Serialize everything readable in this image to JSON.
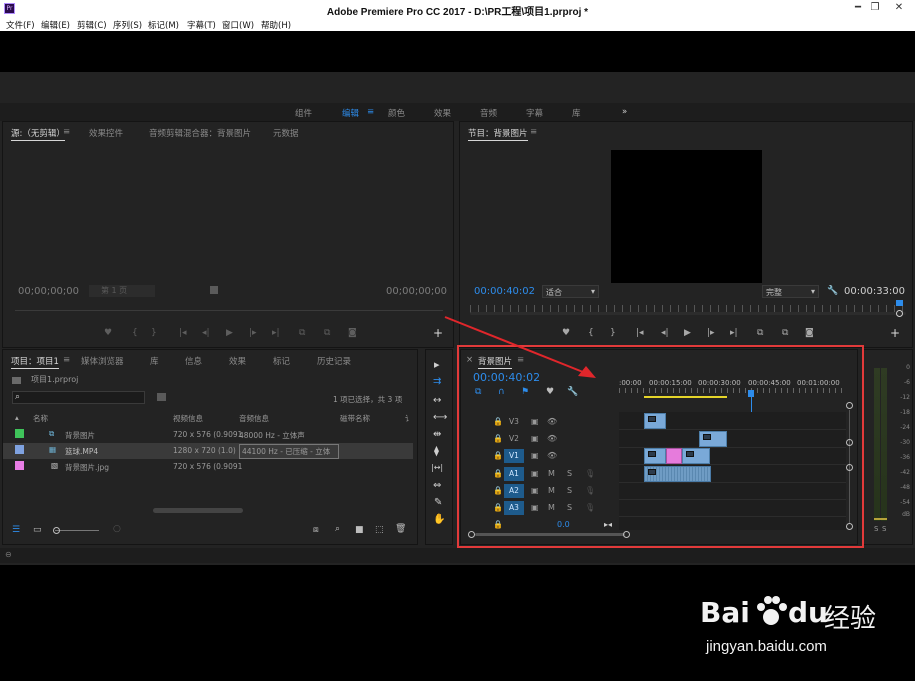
{
  "window": {
    "title": "Adobe Premiere Pro CC 2017 - D:\\PR工程\\项目1.prproj *",
    "app_icon_text": "Pr",
    "min": "━",
    "restore": "❐",
    "close": "✕"
  },
  "menu": [
    "文件(F)",
    "编辑(E)",
    "剪辑(C)",
    "序列(S)",
    "标记(M)",
    "字幕(T)",
    "窗口(W)",
    "帮助(H)"
  ],
  "workspaces": {
    "items": [
      "组件",
      "编辑",
      "颜色",
      "效果",
      "音频",
      "字幕",
      "库"
    ],
    "active_index": 1,
    "more": "»",
    "menu_icon": "≡"
  },
  "source": {
    "tabs": [
      "源:（无剪辑）",
      "效果控件",
      "音频剪辑混合器：背景图片",
      "元数据"
    ],
    "tab_menu": "≡",
    "timecode_left": "00;00;00;00",
    "timecode_right": "00;00;00;00",
    "page_label": "第 1 页",
    "controls": [
      "♥",
      "{",
      "}",
      "|◂",
      "◂|",
      "▶",
      "|▸",
      "▸|",
      "⧉",
      "⧉",
      "◙"
    ],
    "add": "+"
  },
  "program": {
    "tab": "节目：背景图片",
    "tab_menu": "≡",
    "timecode_left": "00:00:40:02",
    "fit": "适合",
    "quality": "完整",
    "wrench": "🔧",
    "timecode_right": "00:00:33:00",
    "controls": [
      "♥",
      "{",
      "}",
      "|◂",
      "◂|",
      "▶",
      "|▸",
      "▸|",
      "⧉",
      "⧉",
      "◙"
    ],
    "add": "+"
  },
  "project": {
    "tabs": [
      "项目：项目1",
      "媒体浏览器",
      "库",
      "信息",
      "效果",
      "标记",
      "历史记录"
    ],
    "tab_menu": "≡",
    "file": "项目1.prproj",
    "search_icon": "⌕",
    "selection_info": "1 项已选择，共 3 项",
    "columns": [
      "名称",
      "视频信息",
      "音频信息",
      "磁带名称",
      "讠"
    ],
    "rows": [
      {
        "color": "#3fc35a",
        "name": "背景图片",
        "video": "720 x 576 (0.9091",
        "audio": "48000 Hz - 立体声"
      },
      {
        "color": "#7fa2e0",
        "name": "篮球.MP4",
        "video": "1280 x 720 (1.0)",
        "audio": "44100 Hz - 已压缩 - 立体"
      },
      {
        "color": "#e87de5",
        "name": "背景图片.jpg",
        "video": "720 x 576 (0.9091",
        "audio": ""
      }
    ],
    "bottom_icons": [
      "☰",
      "▭",
      "○",
      "⧈",
      "⌕",
      "■",
      "⬚",
      "🗑"
    ]
  },
  "tools": [
    "▸",
    "⇉",
    "↔",
    "⟷",
    "⇹",
    "⧫",
    "|↔|",
    "⇔",
    "✎",
    "✋"
  ],
  "timeline": {
    "tab": "背景图片",
    "tab_close": "×",
    "tab_menu": "≡",
    "timecode": "00:00:40:02",
    "ruler": [
      ":00:00",
      "00:00:15:00",
      "00:00:30:00",
      "00:00:45:00",
      "00:01:00:00"
    ],
    "tracks": [
      {
        "label": "V3",
        "on": false
      },
      {
        "label": "V2",
        "on": false
      },
      {
        "label": "V1",
        "on": true
      },
      {
        "label": "A1",
        "on": true
      },
      {
        "label": "A2",
        "on": true
      },
      {
        "label": "A3",
        "on": true
      }
    ],
    "audio_btns": [
      "M",
      "S"
    ],
    "master_value": "0.0",
    "lock_icon": "🔒",
    "eye_icon": "👁",
    "film_icon": "▣",
    "mic_icon": "🎙"
  },
  "meters": {
    "labels": [
      "0",
      "-6",
      "-12",
      "-18",
      "-24",
      "-30",
      "-36",
      "-42",
      "-48",
      "-54",
      "dB"
    ],
    "solo": [
      "S",
      "S"
    ]
  },
  "watermark": {
    "brand": "Bai",
    "brand_tail": "du",
    "product": "经验",
    "url": "jingyan.baidu.com"
  },
  "colors": {
    "accent": "#2d8ceb",
    "highlight_box": "#e23a3a",
    "arrow": "#e0262b"
  }
}
